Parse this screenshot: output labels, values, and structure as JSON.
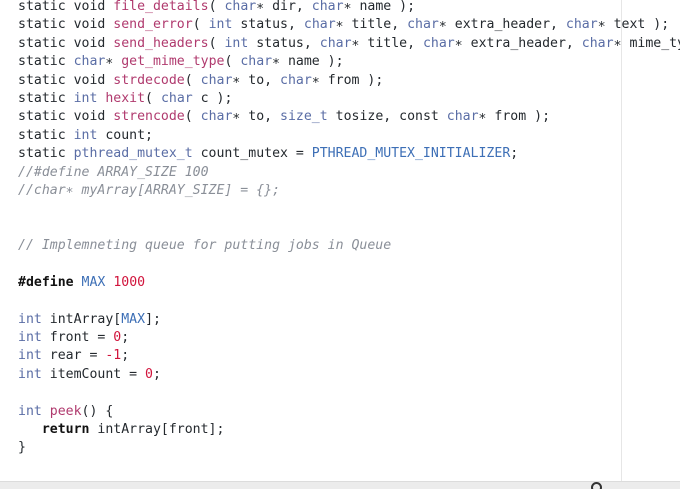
{
  "editor": {
    "lines": [
      [
        {
          "t": "static ",
          "c": "kw"
        },
        {
          "t": "void ",
          "c": "kw"
        },
        {
          "t": "file_details",
          "c": "fn"
        },
        {
          "t": "( ",
          "c": "plain"
        },
        {
          "t": "char",
          "c": "type"
        },
        {
          "t": "∗ dir, ",
          "c": "plain"
        },
        {
          "t": "char",
          "c": "type"
        },
        {
          "t": "∗ name );",
          "c": "plain"
        }
      ],
      [
        {
          "t": "static ",
          "c": "kw"
        },
        {
          "t": "void ",
          "c": "kw"
        },
        {
          "t": "send_error",
          "c": "fn"
        },
        {
          "t": "( ",
          "c": "plain"
        },
        {
          "t": "int",
          "c": "type"
        },
        {
          "t": " status, ",
          "c": "plain"
        },
        {
          "t": "char",
          "c": "type"
        },
        {
          "t": "∗ title, ",
          "c": "plain"
        },
        {
          "t": "char",
          "c": "type"
        },
        {
          "t": "∗ extra_header, ",
          "c": "plain"
        },
        {
          "t": "char",
          "c": "type"
        },
        {
          "t": "∗ text );",
          "c": "plain"
        }
      ],
      [
        {
          "t": "static ",
          "c": "kw"
        },
        {
          "t": "void ",
          "c": "kw"
        },
        {
          "t": "send_headers",
          "c": "fn"
        },
        {
          "t": "( ",
          "c": "plain"
        },
        {
          "t": "int",
          "c": "type"
        },
        {
          "t": " status, ",
          "c": "plain"
        },
        {
          "t": "char",
          "c": "type"
        },
        {
          "t": "∗ title, ",
          "c": "plain"
        },
        {
          "t": "char",
          "c": "type"
        },
        {
          "t": "∗ extra_header, ",
          "c": "plain"
        },
        {
          "t": "char",
          "c": "type"
        },
        {
          "t": "∗ mime_type,",
          "c": "plain"
        }
      ],
      [
        {
          "t": "static ",
          "c": "kw"
        },
        {
          "t": "char",
          "c": "type"
        },
        {
          "t": "∗ ",
          "c": "plain"
        },
        {
          "t": "get_mime_type",
          "c": "fn"
        },
        {
          "t": "( ",
          "c": "plain"
        },
        {
          "t": "char",
          "c": "type"
        },
        {
          "t": "∗ name );",
          "c": "plain"
        }
      ],
      [
        {
          "t": "static ",
          "c": "kw"
        },
        {
          "t": "void ",
          "c": "kw"
        },
        {
          "t": "strdecode",
          "c": "fn"
        },
        {
          "t": "( ",
          "c": "plain"
        },
        {
          "t": "char",
          "c": "type"
        },
        {
          "t": "∗ to, ",
          "c": "plain"
        },
        {
          "t": "char",
          "c": "type"
        },
        {
          "t": "∗ from );",
          "c": "plain"
        }
      ],
      [
        {
          "t": "static ",
          "c": "kw"
        },
        {
          "t": "int ",
          "c": "type"
        },
        {
          "t": "hexit",
          "c": "fn"
        },
        {
          "t": "( ",
          "c": "plain"
        },
        {
          "t": "char",
          "c": "type"
        },
        {
          "t": " c );",
          "c": "plain"
        }
      ],
      [
        {
          "t": "static ",
          "c": "kw"
        },
        {
          "t": "void ",
          "c": "kw"
        },
        {
          "t": "strencode",
          "c": "fn"
        },
        {
          "t": "( ",
          "c": "plain"
        },
        {
          "t": "char",
          "c": "type"
        },
        {
          "t": "∗ to, ",
          "c": "plain"
        },
        {
          "t": "size_t",
          "c": "type"
        },
        {
          "t": " tosize, const ",
          "c": "plain"
        },
        {
          "t": "char",
          "c": "type"
        },
        {
          "t": "∗ from );",
          "c": "plain"
        }
      ],
      [
        {
          "t": "static ",
          "c": "kw"
        },
        {
          "t": "int",
          "c": "type"
        },
        {
          "t": " count;",
          "c": "plain"
        }
      ],
      [
        {
          "t": "static ",
          "c": "kw"
        },
        {
          "t": "pthread_mutex_t",
          "c": "type"
        },
        {
          "t": " count_mutex = ",
          "c": "plain"
        },
        {
          "t": "PTHREAD_MUTEX_INITIALIZER",
          "c": "macro"
        },
        {
          "t": ";",
          "c": "plain"
        }
      ],
      [
        {
          "t": "//#define ARRAY_SIZE 100",
          "c": "comment"
        }
      ],
      [
        {
          "t": "//char∗ myArray[ARRAY_SIZE] = {};",
          "c": "comment"
        }
      ],
      [],
      [],
      [
        {
          "t": "// Implemneting queue for putting jobs in Queue",
          "c": "comment"
        }
      ],
      [],
      [
        {
          "t": "#define",
          "c": "kwb"
        },
        {
          "t": " ",
          "c": "plain"
        },
        {
          "t": "MAX",
          "c": "macro"
        },
        {
          "t": " ",
          "c": "plain"
        },
        {
          "t": "1000",
          "c": "num"
        }
      ],
      [],
      [
        {
          "t": "int",
          "c": "type"
        },
        {
          "t": " intArray[",
          "c": "plain"
        },
        {
          "t": "MAX",
          "c": "macro"
        },
        {
          "t": "];",
          "c": "plain"
        }
      ],
      [
        {
          "t": "int",
          "c": "type"
        },
        {
          "t": " front = ",
          "c": "plain"
        },
        {
          "t": "0",
          "c": "num"
        },
        {
          "t": ";",
          "c": "plain"
        }
      ],
      [
        {
          "t": "int",
          "c": "type"
        },
        {
          "t": " rear = ",
          "c": "plain"
        },
        {
          "t": "-1",
          "c": "num"
        },
        {
          "t": ";",
          "c": "plain"
        }
      ],
      [
        {
          "t": "int",
          "c": "type"
        },
        {
          "t": " itemCount = ",
          "c": "plain"
        },
        {
          "t": "0",
          "c": "num"
        },
        {
          "t": ";",
          "c": "plain"
        }
      ],
      [],
      [
        {
          "t": "int",
          "c": "type"
        },
        {
          "t": " ",
          "c": "plain"
        },
        {
          "t": "peek",
          "c": "fn"
        },
        {
          "t": "() {",
          "c": "plain"
        }
      ],
      [
        {
          "t": "   ",
          "c": "plain"
        },
        {
          "t": "return",
          "c": "kwb"
        },
        {
          "t": " intArray[front];",
          "c": "plain"
        }
      ],
      [
        {
          "t": "}",
          "c": "plain"
        }
      ]
    ]
  },
  "colors": {
    "background": "#ffffff",
    "text": "#24292e",
    "type": "#5a6da5",
    "function": "#b03a6e",
    "number": "#d1143c",
    "macro": "#3d6fb6",
    "comment": "#8a8f98"
  }
}
